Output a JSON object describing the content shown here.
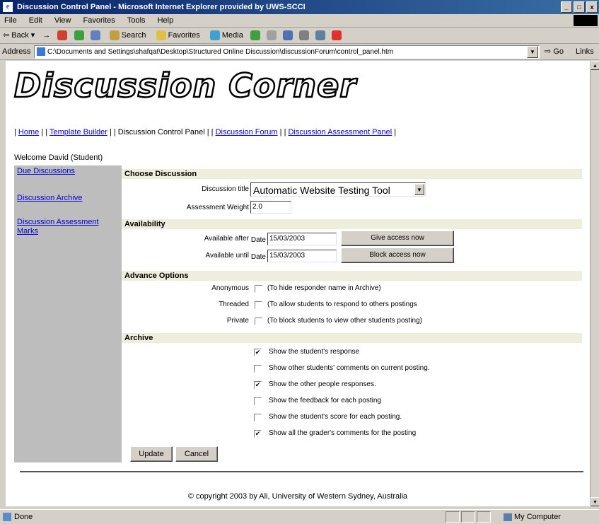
{
  "window": {
    "title": "Discussion Control Panel - Microsoft Internet Explorer provided by UWS-SCCI",
    "buttons": {
      "minimize": "_",
      "maximize": "□",
      "close": "x"
    }
  },
  "menubar": [
    "File",
    "Edit",
    "View",
    "Favorites",
    "Tools",
    "Help"
  ],
  "toolbar": {
    "back": "Back",
    "forward": "→",
    "search": "Search",
    "favorites": "Favorites",
    "media": "Media"
  },
  "addressbar": {
    "label": "Address",
    "url": "C:\\Documents and Settings\\shafqat\\Desktop\\Structured Online Discussion\\discussionForum\\control_panel.htm",
    "go": "Go",
    "links": "Links"
  },
  "page": {
    "logo": "Discussion Corner",
    "nav": {
      "sep_open": "| ",
      "sep_mid": " | | ",
      "sep_close": " |",
      "home": "Home",
      "template_builder": "Template Builder",
      "control_panel": "Discussion Control Panel",
      "forum": "Discussion Forum",
      "assessment_panel": "Discussion Assessment Panel"
    },
    "welcome": "Welcome David (Student)",
    "sidebar": [
      "Due Discussions",
      "Discussion Archive",
      "Discussion Assessment Marks"
    ],
    "sections": {
      "choose": "Choose Discussion",
      "availability": "Availability",
      "advance": "Advance Options",
      "archive": "Archive"
    },
    "choose": {
      "title_label": "Discussion title",
      "title_value": "Automatic Website Testing Tool",
      "weight_label": "Assessment Weight",
      "weight_value": "2.0"
    },
    "availability": {
      "after_label": "Available after",
      "after_date_label": "Date",
      "after_date_value": "15/03/2003",
      "give_button": "Give access now",
      "until_label": "Available until",
      "until_date_label": "Date",
      "until_date_value": "15/03/2003",
      "block_button": "Block access now"
    },
    "advance": [
      {
        "label": "Anonymous",
        "desc": "(To hide responder name in Archive)",
        "checked": false
      },
      {
        "label": "Threaded",
        "desc": "(To allow students to respond to others postings",
        "checked": false
      },
      {
        "label": "Private",
        "desc": "(To block students to view other students posting)",
        "checked": false
      }
    ],
    "archive": [
      {
        "desc": "Show the student's response",
        "checked": true
      },
      {
        "desc": "Show other students' comments on current posting.",
        "checked": false
      },
      {
        "desc": "Show the other people responses.",
        "checked": true
      },
      {
        "desc": "Show the feedback for each posting",
        "checked": false
      },
      {
        "desc": "Show the student's score for each posting.",
        "checked": false
      },
      {
        "desc": "Show all the grader's comments for the posting",
        "checked": true
      }
    ],
    "buttons": {
      "update": "Update",
      "cancel": "Cancel"
    },
    "footer": "© copyright 2003 by Ali, University of Western Sydney, Australia"
  },
  "statusbar": {
    "text": "Done",
    "zone": "My Computer"
  }
}
